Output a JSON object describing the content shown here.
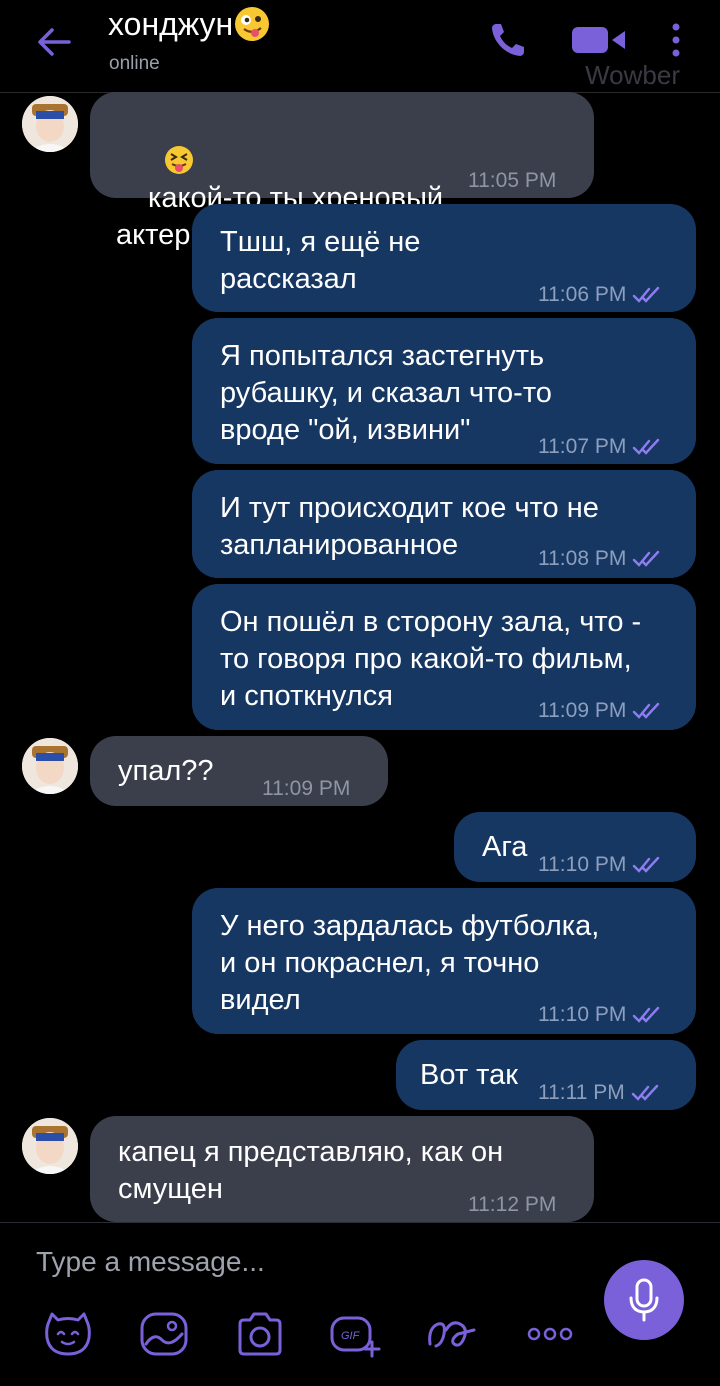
{
  "header": {
    "contact_name": "хонджун",
    "status": "online",
    "watermark": "Wowber",
    "accent": "#7a61da"
  },
  "messages": [
    {
      "dir": "in",
      "text": "какой-то ты хреновый\nактер",
      "time": "11:05 PM",
      "emoji": "squinting-tongue-face"
    },
    {
      "dir": "out",
      "text": "Тшш, я ещё не\nрассказал",
      "time": "11:06 PM"
    },
    {
      "dir": "out",
      "text": "Я попытался застегнуть\nрубашку, и сказал что-то\nвроде \"ой, извини\"",
      "time": "11:07 PM"
    },
    {
      "dir": "out",
      "text": "И тут происходит кое что не\nзапланированное",
      "time": "11:08 PM"
    },
    {
      "dir": "out",
      "text": "Он пошёл в сторону зала, что -\nто говоря про какой-то фильм,\nи споткнулся",
      "time": "11:09 PM"
    },
    {
      "dir": "in",
      "text": "упал??",
      "time": "11:09 PM"
    },
    {
      "dir": "out",
      "text": "Ага",
      "time": "11:10 PM"
    },
    {
      "dir": "out",
      "text": "У него зардалась футболка,\nи он покраснел, я точно\nвидел",
      "time": "11:10 PM"
    },
    {
      "dir": "out",
      "text": "Вот так",
      "time": "11:11 PM"
    },
    {
      "dir": "in",
      "text": "капец я представляю, как он\nсмущен",
      "time": "11:12 PM"
    }
  ],
  "composer": {
    "placeholder": "Type a message...",
    "tools": [
      "sticker-icon",
      "gallery-icon",
      "camera-icon",
      "gif-icon",
      "doodle-icon",
      "more-icon"
    ]
  },
  "colors": {
    "incoming_bubble": "#3a3f4b",
    "outgoing_bubble": "#173763",
    "read_ticks": "#8f7cf0"
  }
}
